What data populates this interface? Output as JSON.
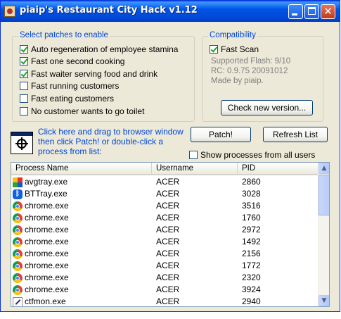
{
  "window": {
    "title": "piaip's Restaurant City Hack v1.12"
  },
  "patches": {
    "legend": "Select patches to enable",
    "items": [
      {
        "label": "Auto regeneration of employee stamina",
        "checked": true
      },
      {
        "label": "Fast one second cooking",
        "checked": true
      },
      {
        "label": "Fast waiter serving food and drink",
        "checked": true
      },
      {
        "label": "Fast running customers",
        "checked": false
      },
      {
        "label": "Fast eating customers",
        "checked": false
      },
      {
        "label": "No customer wants to go toilet",
        "checked": false
      }
    ]
  },
  "compat": {
    "legend": "Compatibility",
    "fast_scan_label": "Fast Scan",
    "fast_scan_checked": true,
    "supported_flash": "Supported Flash: 9/10",
    "rc": "RC: 0.9.75 20091012",
    "made_by": "Made by piaip.",
    "check_button": "Check new version..."
  },
  "actions": {
    "drag_text": "Click here and drag to browser window then click Patch! or double-click a process from list:",
    "patch_button": "Patch!",
    "refresh_button": "Refresh List",
    "show_all_label": "Show processes from all users",
    "show_all_checked": false
  },
  "process_list": {
    "columns": [
      "Process Name",
      "Username",
      "PID"
    ],
    "rows": [
      {
        "name": "avgtray.exe",
        "user": "ACER",
        "pid": "2860",
        "icon": "avg-icon"
      },
      {
        "name": "BTTray.exe",
        "user": "ACER",
        "pid": "3028",
        "icon": "bluetooth-icon"
      },
      {
        "name": "chrome.exe",
        "user": "ACER",
        "pid": "3516",
        "icon": "chrome-icon"
      },
      {
        "name": "chrome.exe",
        "user": "ACER",
        "pid": "1760",
        "icon": "chrome-icon"
      },
      {
        "name": "chrome.exe",
        "user": "ACER",
        "pid": "2972",
        "icon": "chrome-icon"
      },
      {
        "name": "chrome.exe",
        "user": "ACER",
        "pid": "1492",
        "icon": "chrome-icon"
      },
      {
        "name": "chrome.exe",
        "user": "ACER",
        "pid": "2156",
        "icon": "chrome-icon"
      },
      {
        "name": "chrome.exe",
        "user": "ACER",
        "pid": "1772",
        "icon": "chrome-icon"
      },
      {
        "name": "chrome.exe",
        "user": "ACER",
        "pid": "2320",
        "icon": "chrome-icon"
      },
      {
        "name": "chrome.exe",
        "user": "ACER",
        "pid": "3924",
        "icon": "chrome-icon"
      },
      {
        "name": "ctfmon.exe",
        "user": "ACER",
        "pid": "2940",
        "icon": "ctfmon-icon"
      }
    ]
  }
}
